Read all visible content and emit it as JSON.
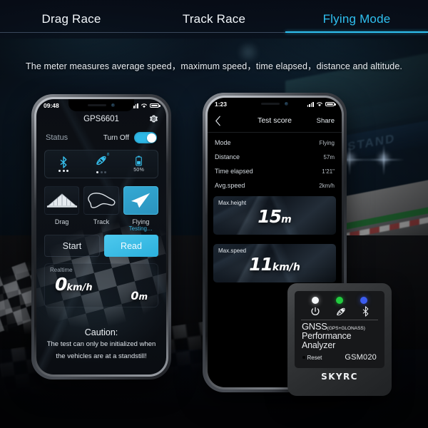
{
  "tabs": [
    {
      "label": "Drag Race",
      "active": false
    },
    {
      "label": "Track Race",
      "active": false
    },
    {
      "label": "Flying Mode",
      "active": true
    }
  ],
  "subtitle": "The meter measures average speed，maximum speed，time elapsed，distance and altitude.",
  "accent_color": "#2fc0f0",
  "left_phone": {
    "status_bar": {
      "time": "09:48"
    },
    "title": "GPS6601",
    "settings_icon": "gear-icon",
    "status_row": {
      "label": "Status",
      "toggle_label": "Turn Off",
      "toggle_on": true
    },
    "status_card": {
      "bluetooth": {
        "icon": "bluetooth-icon",
        "signal_dots": 3,
        "active_dots": 3
      },
      "satellite": {
        "icon": "satellite-icon",
        "badge": "8",
        "signal_dots": 3,
        "active_dots": 1
      },
      "battery": {
        "icon": "battery-icon",
        "percent_label": "50%"
      }
    },
    "modes": [
      {
        "label": "Drag",
        "icon": "drag-strip-icon",
        "sub": "",
        "selected": false
      },
      {
        "label": "Track",
        "icon": "race-track-icon",
        "sub": "",
        "selected": false
      },
      {
        "label": "Flying",
        "icon": "paper-plane-icon",
        "sub": "Testing…",
        "selected": true
      }
    ],
    "buttons": {
      "start": "Start",
      "read": "Read"
    },
    "realtime": {
      "label": "Realtime",
      "speed_value": "0",
      "speed_unit": "km/h",
      "altitude_value": "0",
      "altitude_unit": "m"
    },
    "caution": {
      "heading": "Caution:",
      "line1": "The test can only be initialized when",
      "line2": "the vehicles are at a standstill!"
    }
  },
  "right_phone": {
    "status_bar": {
      "time": "1:23"
    },
    "nav": {
      "back_icon": "chevron-left-icon",
      "title": "Test score",
      "action": "Share"
    },
    "rows": [
      {
        "key": "Mode",
        "value": "Flying"
      },
      {
        "key": "Distance",
        "value": "57m"
      },
      {
        "key": "Time elapsed",
        "value": "1'21\""
      },
      {
        "key": "Avg.speed",
        "value": "2km/h"
      }
    ],
    "metrics": [
      {
        "label": "Max.height",
        "value": "15",
        "unit": "m"
      },
      {
        "label": "Max.speed",
        "value": "11",
        "unit": "km/h"
      }
    ]
  },
  "device": {
    "leds": [
      {
        "name": "power-led",
        "color": "#f4f6f8"
      },
      {
        "name": "satellite-led",
        "color": "#22cc3f"
      },
      {
        "name": "bluetooth-led",
        "color": "#3b5cf0"
      }
    ],
    "icons": [
      "power-icon",
      "satellite-icon",
      "bluetooth-icon"
    ],
    "title_line1": "GNSS",
    "title_line1_sub": "(GPS+GLONASS)",
    "title_line2": "Performance",
    "title_line3": "Analyzer",
    "reset_label": "Reset",
    "model": "GSM020",
    "brand": "SKYRC"
  }
}
